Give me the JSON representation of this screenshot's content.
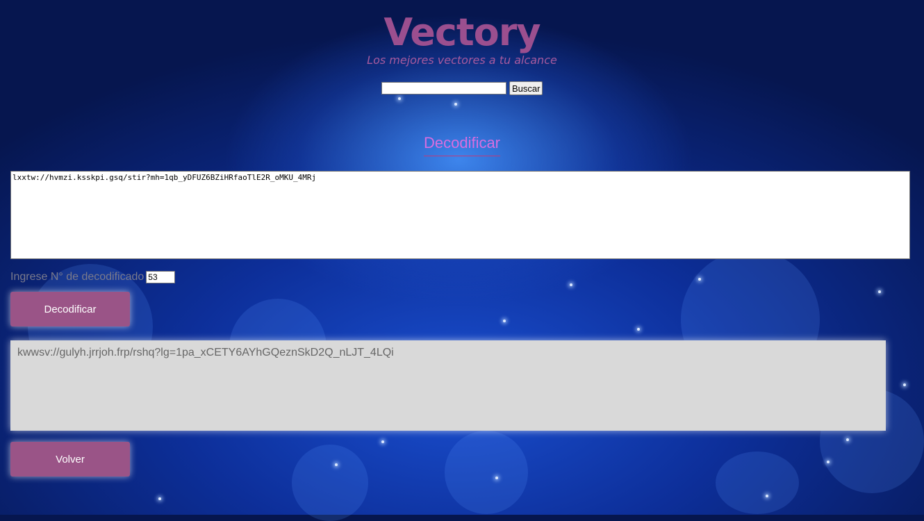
{
  "header": {
    "logo_text": "Vectory",
    "tagline": "Los mejores vectores a tu alcance",
    "search_value": "",
    "search_button_label": "Buscar"
  },
  "main": {
    "section_title": "Decodificar",
    "input_text": "lxxtw://hvmzi.ksskpi.gsq/stir?mh=1qb_yDFUZ6BZiHRfaoTlE2R_oMKU_4MRj",
    "key_label": "Ingrese N° de decodificado",
    "key_value": "53",
    "decode_button_label": "Decodificar",
    "output_text": "kwwsv://gulyh.jrrjoh.frp/rshq?lg=1pa_xCETY6AYhGQeznSkD2Q_nLJT_4LQi",
    "back_button_label": "Volver"
  },
  "colors": {
    "brand_purple": "#9b4f8f",
    "tagline_purple": "#a65a9e",
    "title_pink": "#d86ee0",
    "button_bg": "#9a5487",
    "label_gray": "#7a7a8c",
    "output_bg": "#d9d9d9"
  }
}
